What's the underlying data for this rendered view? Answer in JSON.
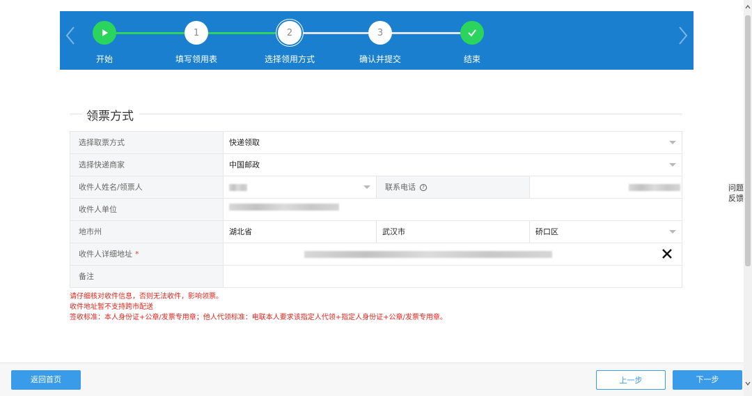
{
  "steps": [
    {
      "number": "",
      "label": "开始"
    },
    {
      "number": "1",
      "label": "填写领用表"
    },
    {
      "number": "2",
      "label": "选择领用方式"
    },
    {
      "number": "3",
      "label": "确认并提交"
    },
    {
      "number": "",
      "label": "结束"
    }
  ],
  "section": {
    "title": "领票方式"
  },
  "form": {
    "pickup_method": {
      "label": "选择取票方式",
      "value": "快递领取"
    },
    "courier": {
      "label": "选择快递商家",
      "value": "中国邮政"
    },
    "recipient_name": {
      "label": "收件人姓名/领票人"
    },
    "phone": {
      "label": "联系电话"
    },
    "recipient_unit": {
      "label": "收件人单位"
    },
    "region": {
      "label": "地市州",
      "province": "湖北省",
      "city": "武汉市",
      "district": "硚口区"
    },
    "address": {
      "label": "收件人详细地址",
      "required_mark": "*"
    },
    "remark": {
      "label": "备注"
    }
  },
  "notes": [
    "请仔细核对收件信息，否则无法收件，影响领票。",
    "收件地址暂不支持跨市配送",
    "签收标准：本人身份证+公章/发票专用章；他人代领标准：电联本人要求该指定人代领+指定人身份证+公章/发票专用章。"
  ],
  "feedback": {
    "label": "问题反馈"
  },
  "footer": {
    "home_label": "返回首页",
    "prev_label": "上一步",
    "next_label": "下一步"
  },
  "colors": {
    "header": "#1b7fd0",
    "step_done": "#2bd45c",
    "button": "#3a9be8",
    "warning": "#e0261d"
  }
}
